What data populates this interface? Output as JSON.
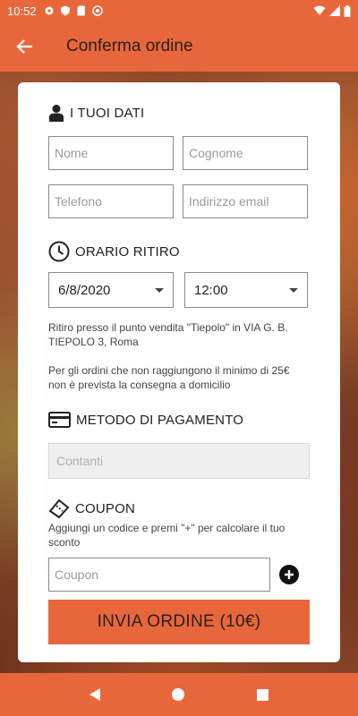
{
  "status_bar": {
    "time": "10:52"
  },
  "app_bar": {
    "title": "Conferma ordine"
  },
  "personal": {
    "heading": "I TUOI DATI",
    "name_placeholder": "Nome",
    "surname_placeholder": "Cognome",
    "phone_placeholder": "Telefono",
    "email_placeholder": "Indirizzo email"
  },
  "pickup": {
    "heading": "ORARIO RITIRO",
    "date": "6/8/2020",
    "time": "12:00",
    "location_note": "Ritiro presso il punto vendita \"Tiepolo\" in VIA G. B. TIEPOLO 3, Roma",
    "minimum_note": "Per gli ordini che non raggiungono il minimo di 25€ non è prevista la consegna a domicilio"
  },
  "payment": {
    "heading": "METODO DI PAGAMENTO",
    "value": "Contanti"
  },
  "coupon": {
    "heading": "COUPON",
    "hint": "Aggiungi un codice e premi \"+\" per calcolare il tuo sconto",
    "placeholder": "Coupon"
  },
  "submit_label": "INVIA ORDINE (10€)",
  "colors": {
    "accent": "#e8673a"
  }
}
